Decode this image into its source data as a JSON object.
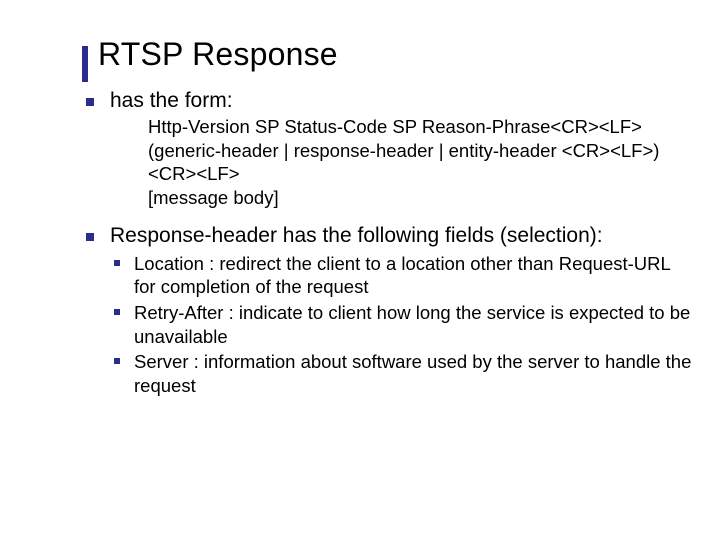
{
  "title": "RTSP Response",
  "bullet1": "has the form:",
  "form": {
    "l1": "Http-Version SP Status-Code SP Reason-Phrase<CR><LF>",
    "l2": "(generic-header | response-header | entity-header <CR><LF>)",
    "l3": "<CR><LF>",
    "l4": "[message body]"
  },
  "bullet2": "Response-header has the following fields (selection):",
  "sub": {
    "a": "Location : redirect the client to a location other than Request-URL for completion of the request",
    "b": "Retry-After : indicate to client how long the service is expected to be unavailable",
    "c": "Server : information about software used by the server to handle the request"
  }
}
